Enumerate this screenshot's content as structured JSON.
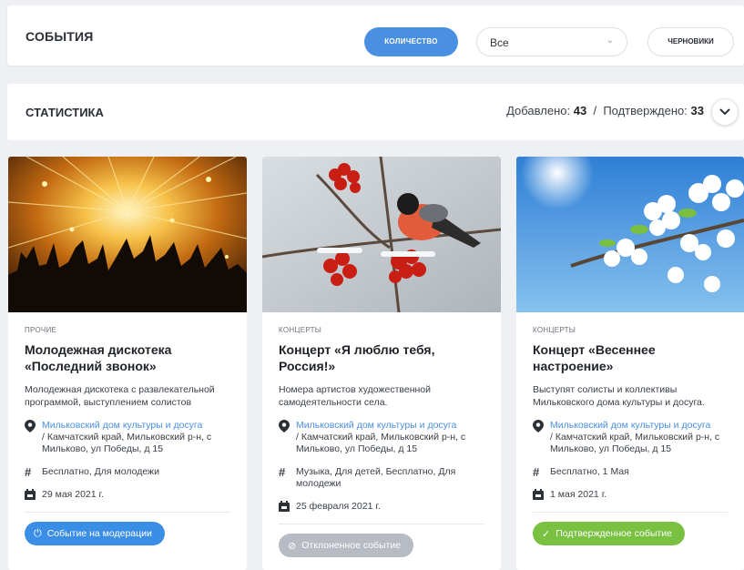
{
  "header": {
    "title": "СОБЫТИЯ",
    "count_button": "КОЛИЧЕСТВО",
    "filter": {
      "value": "Все"
    },
    "drafts_button": "ЧЕРНОВИКИ"
  },
  "stats": {
    "title": "СТАТИСТИКА",
    "added_label": "Добавлено:",
    "added_value": "43",
    "separator": "/",
    "confirmed_label": "Подтверждено:",
    "confirmed_value": "33"
  },
  "colors": {
    "accent": "#4a90e2",
    "link": "#4a8fde",
    "moderation": "#3b8ee6",
    "rejected": "#b7bbc4",
    "confirmed": "#7ac142"
  },
  "cards": [
    {
      "category": "ПРОЧИЕ",
      "title": "Молодежная дискотека «Последний звонок»",
      "description": "Молодежная дискотека с развлекательной программой, выступлением солистов",
      "place_link": "Мильковский дом культуры и досуга",
      "address": "/ Камчатский край, Мильковский р-н, с Мильково, ул Победы, д 15",
      "tags": "Бесплатно, Для молодежи",
      "date": "29 мая 2021 г.",
      "status": "Событие на модерации",
      "status_icon": "power-icon"
    },
    {
      "category": "КОНЦЕРТЫ",
      "title": "Концерт «Я люблю тебя, Россия!»",
      "description": "Номера артистов художественной самодеятельности села.",
      "place_link": "Мильковский дом культуры и досуга",
      "address": "/ Камчатский край, Мильковский р-н, с Мильково, ул Победы, д 15",
      "tags": "Музыка, Для детей, Бесплатно, Для молодежи",
      "date": "25 февраля 2021 г.",
      "status": "Отклоненное событие",
      "status_icon": "ban-icon"
    },
    {
      "category": "КОНЦЕРТЫ",
      "title": "Концерт «Весеннее настроение»",
      "description": "Выступят солисты и коллективы Мильковского дома культуры и досуга.",
      "place_link": "Мильковский дом культуры и досуга",
      "address": "/ Камчатский край, Мильковский р-н, с Мильково, ул Победы, д 15",
      "tags": "Бесплатно, 1 Мая",
      "date": "1 мая 2021 г.",
      "status": "Подтвержденное событие",
      "status_icon": "check-icon"
    }
  ]
}
